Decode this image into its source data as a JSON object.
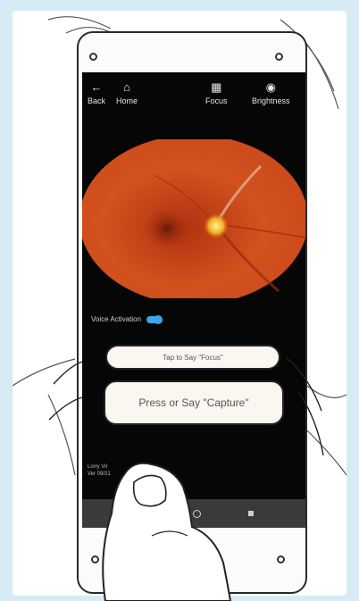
{
  "nav": {
    "back_label": "Back",
    "home_label": "Home",
    "focus_label": "Focus",
    "brightness_label": "Brightness"
  },
  "voice": {
    "label": "Voice Activation",
    "enabled": true
  },
  "buttons": {
    "focus_label": "Tap to Say \"Focus\"",
    "capture_label": "Press or Say \"Capture\""
  },
  "status": {
    "line1": "Lorry Vir",
    "line2": "Ver 09/21"
  },
  "colors": {
    "background": "#d6ebf5",
    "screen": "#060606",
    "toggle": "#3aa8e6",
    "fundus": "#c8401a"
  },
  "icons": {
    "back": "arrow-left-icon",
    "home": "home-icon",
    "focus": "focus-icon",
    "brightness": "bulb-icon"
  }
}
